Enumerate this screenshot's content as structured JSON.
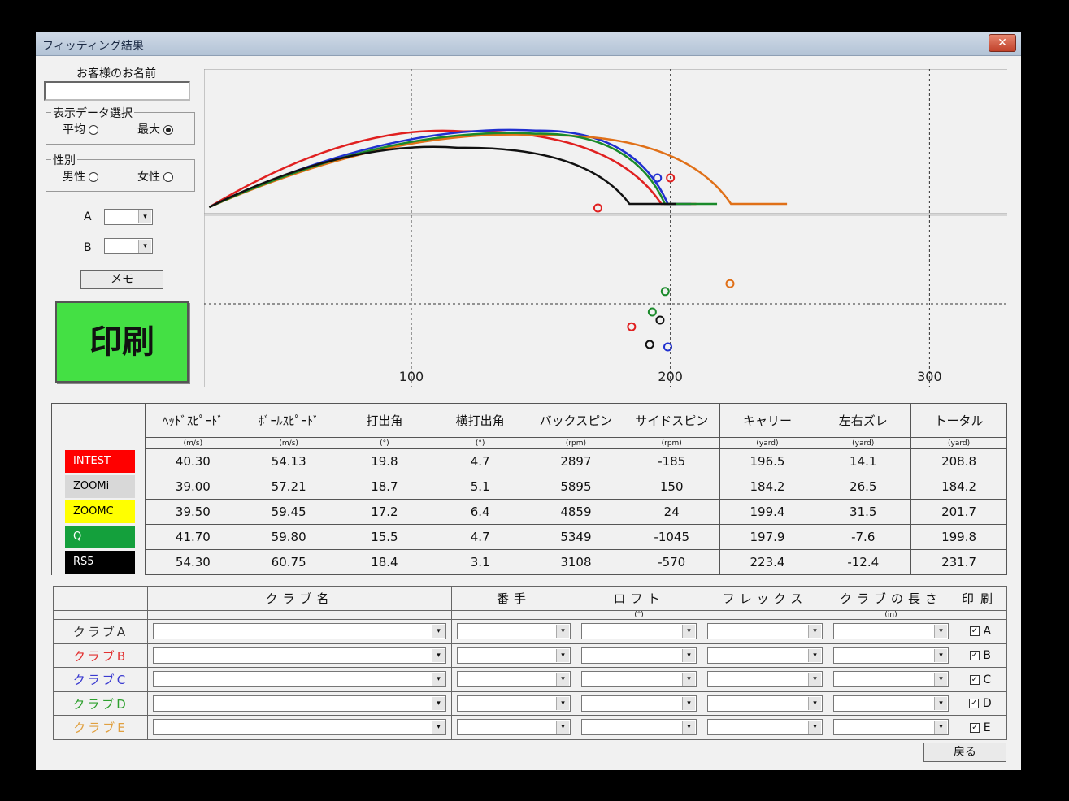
{
  "window": {
    "title": "フィッティング結果",
    "close_label": "✕"
  },
  "left_panel": {
    "customer_name_label": "お客様のお名前",
    "customer_name_value": "",
    "display_group": {
      "title": "表示データ選択",
      "avg_label": "平均",
      "max_label": "最大",
      "selected": "最大"
    },
    "gender_group": {
      "title": "性別",
      "male_label": "男性",
      "female_label": "女性",
      "selected": ""
    },
    "combo_a_label": "A",
    "combo_b_label": "B",
    "memo_label": "メモ",
    "print_label": "印刷"
  },
  "chart_data": {
    "type": "scatter",
    "title": "",
    "x_ticks": [
      "100",
      "200",
      "300"
    ],
    "xlim": [
      20,
      330
    ],
    "colors": {
      "INTEST": "#e02020",
      "ZOOMi": "#2030d0",
      "ZOOMC": "#e07018",
      "Q": "#1a8a2a",
      "RS5": "#111111"
    },
    "trajectories": [
      {
        "name": "INTEST",
        "apex_x": 120,
        "apex_h": 0.93,
        "carry": 196.5,
        "end": 210
      },
      {
        "name": "ZOOMi",
        "apex_x": 148,
        "apex_h": 0.94,
        "carry": 199.0,
        "end": 208
      },
      {
        "name": "ZOOMC",
        "apex_x": 150,
        "apex_h": 0.88,
        "carry": 223.4,
        "end": 245
      },
      {
        "name": "Q",
        "apex_x": 148,
        "apex_h": 0.9,
        "carry": 197.9,
        "end": 218
      },
      {
        "name": "RS5",
        "apex_x": 118,
        "apex_h": 0.72,
        "carry": 184.2,
        "end": 202
      }
    ],
    "landing_points": [
      {
        "name": "INTEST",
        "x": 185,
        "y": 14.1
      },
      {
        "name": "ZOOMi",
        "x": 199,
        "y": 26.5
      },
      {
        "name": "ZOOMC",
        "x": 223,
        "y": -12.4
      },
      {
        "name": "Q",
        "x": 198,
        "y": -7.6
      },
      {
        "name": "RS5",
        "x": 196,
        "y": 10.0
      },
      {
        "name": "Q",
        "x": 193,
        "y": 5.0
      },
      {
        "name": "RS5",
        "x": 192,
        "y": 25.0
      }
    ],
    "apex_markers": [
      {
        "name": "INTEST",
        "x": 172,
        "type": "ground"
      },
      {
        "name": "ZOOMi",
        "x": 195,
        "type": "air"
      },
      {
        "name": "INTEST",
        "x": 200,
        "type": "air"
      }
    ]
  },
  "results": {
    "headers": [
      "ﾍｯﾄﾞｽﾋﾟｰﾄﾞ",
      "ﾎﾞｰﾙｽﾋﾟｰﾄﾞ",
      "打出角",
      "横打出角",
      "バックスピン",
      "サイドスピン",
      "キャリー",
      "左右ズレ",
      "トータル"
    ],
    "units": [
      "(m/s)",
      "(m/s)",
      "(°)",
      "(°)",
      "(rpm)",
      "(rpm)",
      "(yard)",
      "(yard)",
      "(yard)"
    ],
    "rows": [
      {
        "label": "INTEST",
        "bg": "#ff0000",
        "fg": "#ffffff",
        "values": [
          "40.30",
          "54.13",
          "19.8",
          "4.7",
          "2897",
          "-185",
          "196.5",
          "14.1",
          "208.8"
        ]
      },
      {
        "label": "ZOOMi",
        "bg": "#d8d8d8",
        "fg": "#000000",
        "values": [
          "39.00",
          "57.21",
          "18.7",
          "5.1",
          "5895",
          "150",
          "184.2",
          "26.5",
          "184.2"
        ]
      },
      {
        "label": "ZOOMC",
        "bg": "#ffff00",
        "fg": "#000000",
        "values": [
          "39.50",
          "59.45",
          "17.2",
          "6.4",
          "4859",
          "24",
          "199.4",
          "31.5",
          "201.7"
        ]
      },
      {
        "label": "Q",
        "bg": "#14a03c",
        "fg": "#ffffff",
        "values": [
          "41.70",
          "59.80",
          "15.5",
          "4.7",
          "5349",
          "-1045",
          "197.9",
          "-7.6",
          "199.8"
        ]
      },
      {
        "label": "RS5",
        "bg": "#000000",
        "fg": "#ffffff",
        "values": [
          "54.30",
          "60.75",
          "18.4",
          "3.1",
          "3108",
          "-570",
          "223.4",
          "-12.4",
          "231.7"
        ]
      }
    ]
  },
  "clubs": {
    "headers": [
      "クラブ名",
      "番手",
      "ロフト",
      "フレックス",
      "クラブの長さ",
      "印刷"
    ],
    "units": [
      "",
      "",
      "(°)",
      "",
      "(in)",
      ""
    ],
    "rows": [
      {
        "label": "クラブA",
        "color": "#333333",
        "print_label": "A",
        "checked": true
      },
      {
        "label": "クラブB",
        "color": "#e23030",
        "print_label": "B",
        "checked": true
      },
      {
        "label": "クラブC",
        "color": "#3a3ad0",
        "print_label": "C",
        "checked": true
      },
      {
        "label": "クラブD",
        "color": "#2ea02e",
        "print_label": "D",
        "checked": true
      },
      {
        "label": "クラブE",
        "color": "#e0a040",
        "print_label": "E",
        "checked": true
      }
    ],
    "back_label": "戻る",
    "check_mark": "✓",
    "combo_arrow": "▾"
  }
}
